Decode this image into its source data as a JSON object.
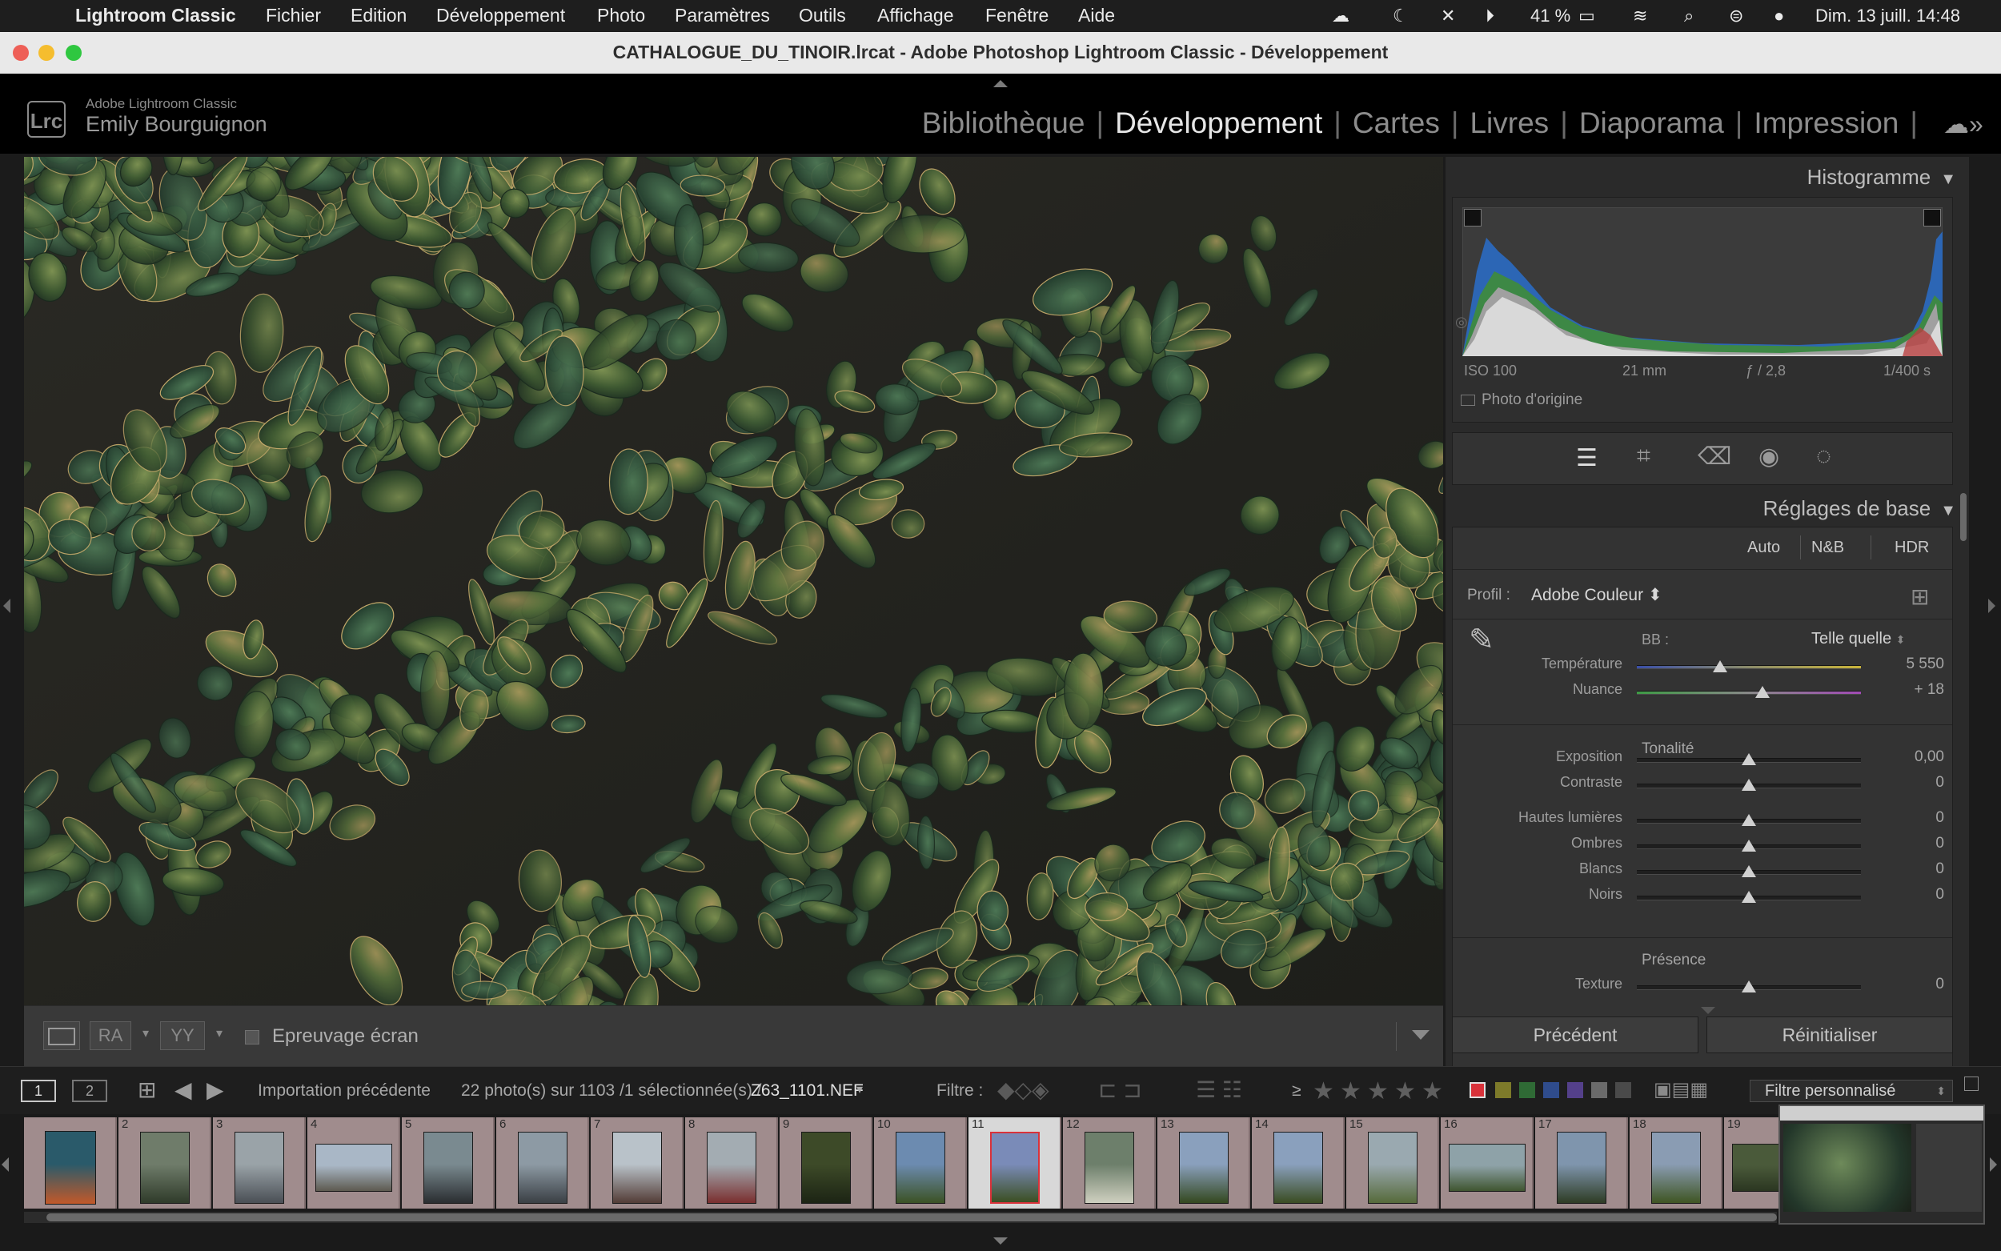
{
  "menubar": {
    "app": "Lightroom Classic",
    "items": [
      "Fichier",
      "Edition",
      "Développement",
      "Photo",
      "Paramètres",
      "Outils",
      "Affichage",
      "Fenêtre",
      "Aide"
    ],
    "battery": "41 %",
    "datetime": "Dim. 13 juill. 14:48"
  },
  "window": {
    "title": "CATHALOGUE_DU_TINOIR.lrcat - Adobe Photoshop Lightroom Classic - Développement"
  },
  "identity": {
    "logo": "Lrc",
    "app_name": "Adobe Lightroom Classic",
    "user": "Emily Bourguignon"
  },
  "modules": [
    "Bibliothèque",
    "Développement",
    "Cartes",
    "Livres",
    "Diaporama",
    "Impression"
  ],
  "active_module": "Développement",
  "toolbar": {
    "before_after_1": "RA",
    "before_after_2": "YY",
    "soft_proof_label": "Epreuvage écran"
  },
  "histogram": {
    "title": "Histogramme",
    "iso": "ISO 100",
    "focal": "21 mm",
    "aperture": "ƒ / 2,8",
    "shutter": "1/400 s",
    "original_photo_label": "Photo d'origine"
  },
  "basic": {
    "title": "Réglages de base",
    "buttons": {
      "auto": "Auto",
      "bw": "N&B",
      "hdr": "HDR"
    },
    "profile_label": "Profil :",
    "profile_value": "Adobe Couleur",
    "wb_label": "BB :",
    "wb_value": "Telle quelle",
    "temperature": {
      "label": "Température",
      "value": "5 550",
      "level": 0.37
    },
    "tint": {
      "label": "Nuance",
      "value": "+ 18",
      "level": 0.56
    },
    "tone_head": "Tonalité",
    "exposure": {
      "label": "Exposition",
      "value": "0,00",
      "level": 0.5
    },
    "contrast": {
      "label": "Contraste",
      "value": "0",
      "level": 0.5
    },
    "highlights": {
      "label": "Hautes lumières",
      "value": "0",
      "level": 0.5
    },
    "shadows": {
      "label": "Ombres",
      "value": "0",
      "level": 0.5
    },
    "whites": {
      "label": "Blancs",
      "value": "0",
      "level": 0.5
    },
    "blacks": {
      "label": "Noirs",
      "value": "0",
      "level": 0.5
    },
    "presence_head": "Présence",
    "texture": {
      "label": "Texture",
      "value": "0",
      "level": 0.5
    }
  },
  "bottom_buttons": {
    "previous": "Précédent",
    "reset": "Réinitialiser"
  },
  "filmstrip_bar": {
    "screen1": "1",
    "screen2": "2",
    "source": "Importation précédente",
    "count": "22 photo(s) sur 1103 /1 sélectionnée(s) /",
    "filename": "Z63_1101.NEF",
    "filter_label": "Filtre :",
    "rating_op": "≥",
    "custom_filter": "Filtre personnalisé"
  },
  "filmstrip": {
    "numbers": [
      "",
      "2",
      "3",
      "4",
      "5",
      "6",
      "7",
      "8",
      "9",
      "10",
      "11",
      "12",
      "13",
      "14",
      "15",
      "16",
      "17",
      "18",
      "19"
    ],
    "selected_index": 10
  },
  "colors": {
    "accent_label_red": "#d9323a",
    "label_yellow": "#c8b02a",
    "label_green": "#3c8a3c",
    "label_blue": "#3b5fb0",
    "label_purple": "#7a4fb0"
  }
}
